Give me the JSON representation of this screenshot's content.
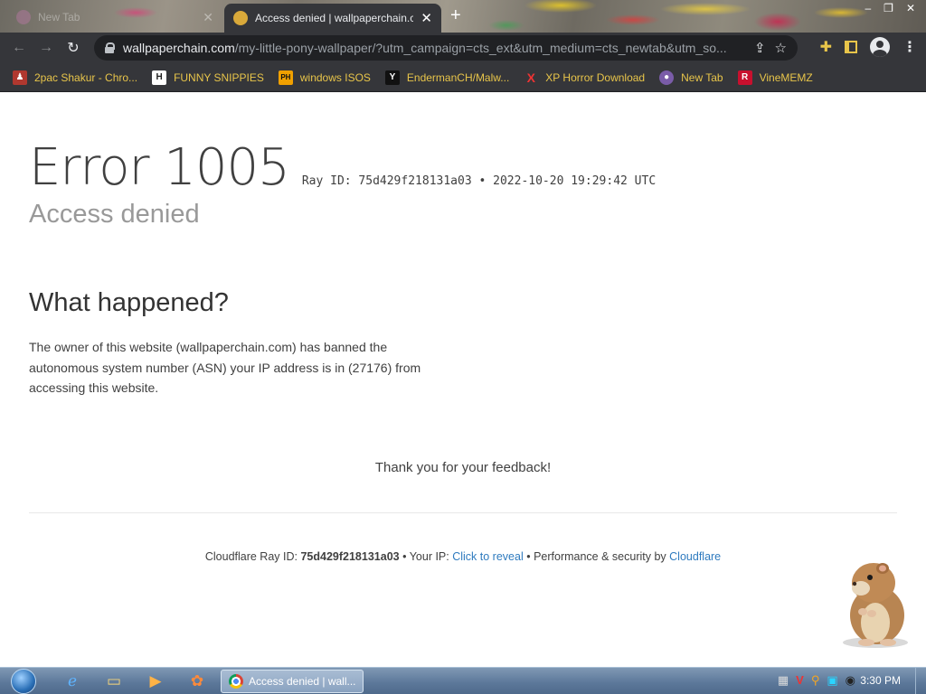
{
  "browser": {
    "tabs": [
      {
        "title": "New Tab",
        "active": false
      },
      {
        "title": "Access denied | wallpaperchain.com",
        "active": true
      }
    ],
    "new_tab_label": "+",
    "window_controls": [
      "–",
      "❐",
      "✕"
    ],
    "url": {
      "host": "wallpaperchain.com",
      "path": "/my-little-pony-wallpaper/?utm_campaign=cts_ext&utm_medium=cts_newtab&utm_so..."
    },
    "bookmarks": [
      {
        "label": "2pac Shakur - Chro...",
        "icon_color": "#b0382f",
        "icon_text": "♟"
      },
      {
        "label": "FUNNY SNIPPIES",
        "icon_color": "#222222",
        "icon_text": "H"
      },
      {
        "label": "windows ISOS",
        "icon_color": "#f0a000",
        "icon_text": "PH"
      },
      {
        "label": "EndermanCH/Malw...",
        "icon_color": "#111111",
        "icon_text": "Y"
      },
      {
        "label": "XP Horror Download",
        "icon_color": "#35363a",
        "icon_text": "X"
      },
      {
        "label": "New Tab",
        "icon_color": "#7a5ca8",
        "icon_text": "●"
      },
      {
        "label": "VineMEMZ",
        "icon_color": "#c8102e",
        "icon_text": "R"
      }
    ]
  },
  "page": {
    "error_code": "Error 1005",
    "ray_text": "Ray ID: 75d429f218131a03 •",
    "timestamp": "2022-10-20 19:29:42 UTC",
    "subtitle": "Access denied",
    "section_heading": "What happened?",
    "paragraph": "The owner of this website (wallpaperchain.com) has banned the autonomous system number (ASN) your IP address is in (27176) from accessing this website.",
    "thanks": "Thank you for your feedback!",
    "footer": {
      "ray_label": "Cloudflare Ray ID:",
      "ray_id": "75d429f218131a03",
      "sep1": "•",
      "ip_label": "Your IP:",
      "reveal_link": "Click to reveal",
      "sep2": "•",
      "perf_label": "Performance & security by",
      "cf_link": "Cloudflare"
    }
  },
  "taskbar": {
    "active_task": "Access denied | wall...",
    "clock": "3:30 PM"
  },
  "colors": {
    "chrome_toolbar": "#35363a",
    "bookmark_text": "#e8c54a",
    "link": "#2f7bbf"
  }
}
